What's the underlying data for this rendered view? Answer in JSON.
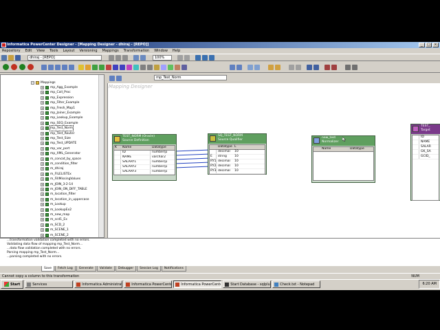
{
  "window": {
    "title": "Informatica PowerCenter Designer - [Mapping Designer - dhiraj - [REPO]]"
  },
  "menu": [
    "Repository",
    "Edit",
    "View",
    "Tools",
    "Layout",
    "Versioning",
    "Mappings",
    "Transformation",
    "Window",
    "Help"
  ],
  "toolbar": {
    "folder_combo": "dhiraj - [REPO]",
    "zoom_combo": "100%",
    "mapping_combo": "mp_Test_Norm"
  },
  "navigator": {
    "root": "Mappings",
    "items": [
      "mp_Agg_Example",
      "mp_Call_Proc",
      "mp_Expression",
      "mp_Filter_Example",
      "mp_Fresh_Map1",
      "mp_Joiner_Example",
      "mp_Lookup_Example",
      "mp_SEQ_Example",
      "mp_Test_Norm",
      "mp_Test_Router",
      "mp_Test_Size",
      "mp_Test_UPDATE",
      "mp_var_port",
      "mp_XML_Generator",
      "m_concat_by_space",
      "m_condition_filter",
      "m_dhiraj",
      "m_FILELISTEx",
      "m_FillMissingValues",
      "m_JOIN_3-2-14",
      "m_JOIN_ON_DIFF_TABLE",
      "m_location_filter",
      "m_location_in_uppercase",
      "m_Lookup",
      "m_LookupEx2",
      "m_new_map",
      "m_scd1_Ex",
      "m_SCD_2",
      "m_SCENE_1",
      "m_SCENE_2"
    ],
    "selected_index": 8
  },
  "canvas": {
    "title": "Mapping Designer",
    "source_def": {
      "title": "TEST_NORM (Oracle)",
      "subtitle": "Source Definition",
      "header": [
        "K",
        "Name",
        "Datatype"
      ],
      "rows": [
        [
          "",
          "ID",
          "number(p"
        ],
        [
          "",
          "NAME",
          "varchar2"
        ],
        [
          "",
          "SALARY1",
          "number(p"
        ],
        [
          "",
          "SALARY2",
          "number(p"
        ],
        [
          "",
          "SALARY3",
          "number(p"
        ]
      ]
    },
    "source_qual": {
      "title": "SQ_TEST_NORM",
      "subtitle": "Source Qualifier",
      "header": [
        "",
        "Datatype",
        "L"
      ],
      "rows": [
        [
          "",
          "decimal",
          "10"
        ],
        [
          "E",
          "string",
          "10"
        ],
        [
          "RY1",
          "decimal",
          "10"
        ],
        [
          "RY2",
          "decimal",
          "10"
        ],
        [
          "RY3",
          "decimal",
          "10"
        ]
      ]
    },
    "normalizer": {
      "title": "new_test",
      "subtitle": "Normalizer",
      "header": [
        "Name",
        "Datatype"
      ]
    },
    "target": {
      "title": "TEST_",
      "subtitle": "Target",
      "rows": [
        "ID",
        "NAME",
        "SALAR",
        "GK_SA",
        "GCID_"
      ]
    }
  },
  "output": {
    "lines": [
      "...transformation validation completed with no errors.",
      "Validating data flow of mapping mp_Test_Norm...",
      "...data flow validation completed with no errors.",
      "Parsing mapping mp_Test_Norm...",
      "...parsing completed with no errors."
    ],
    "tabs": [
      "Save",
      "Fetch Log",
      "Generate",
      "Validate",
      "Debugger",
      "Session Log",
      "Notifications"
    ],
    "active_tab": 0
  },
  "status": {
    "message": "Cannot copy a column to this transformation",
    "num": "NUM"
  },
  "taskbar": {
    "start": "Start",
    "tasks": [
      "Services",
      "Informatica Administrati...",
      "Informatica PowerCenter...",
      "Informatica PowerCenter...",
      "Start Database - sqlplus",
      "Check.txt - Notepad"
    ],
    "active_index": 3,
    "clock": "6:20 AM"
  }
}
